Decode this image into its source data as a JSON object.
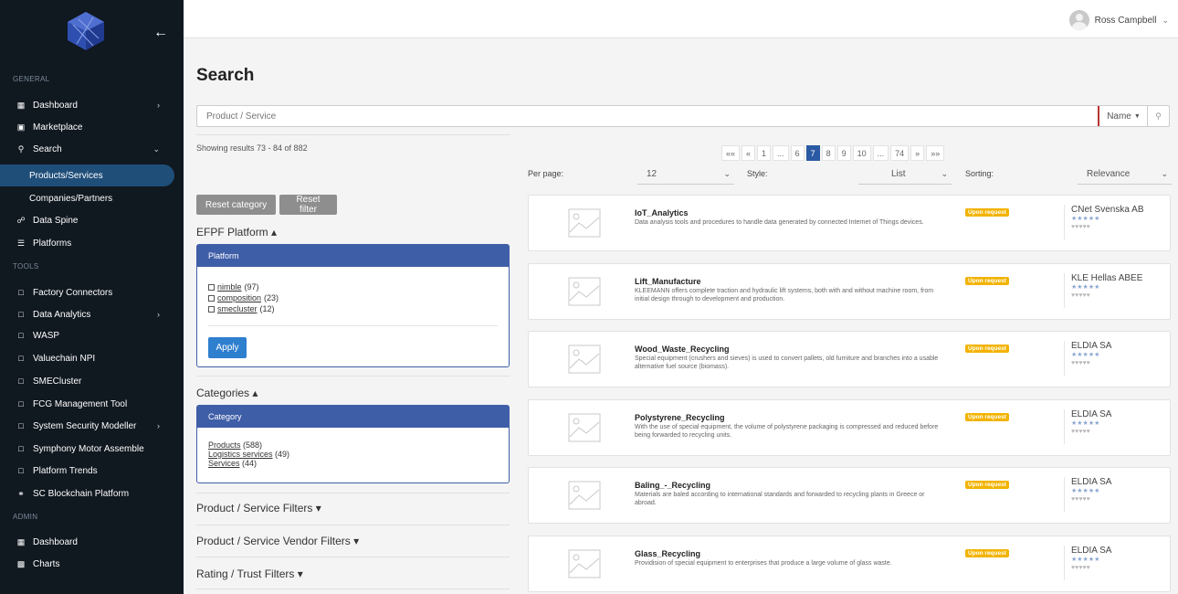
{
  "sidebar": {
    "collapse_icon": "arrow-left-icon",
    "sections": {
      "general": "GENERAL",
      "tools": "TOOLS",
      "admin": "ADMIN"
    },
    "items": [
      {
        "label": "Dashboard"
      },
      {
        "label": "Marketplace"
      },
      {
        "label": "Search"
      },
      {
        "label": "Products/Services"
      },
      {
        "label": "Companies/Partners"
      },
      {
        "label": "Data Spine"
      },
      {
        "label": "Platforms"
      },
      {
        "label": "Factory Connectors"
      },
      {
        "label": "Data Analytics"
      },
      {
        "label": "WASP"
      },
      {
        "label": "Valuechain NPI"
      },
      {
        "label": "SMECluster"
      },
      {
        "label": "FCG Management Tool"
      },
      {
        "label": "System Security Modeller"
      },
      {
        "label": "Symphony Motor Assemble"
      },
      {
        "label": "Platform Trends"
      },
      {
        "label": "SC Blockchain Platform"
      },
      {
        "label": "Dashboard"
      },
      {
        "label": "Charts"
      }
    ]
  },
  "header": {
    "user_name": "Ross Campbell"
  },
  "main": {
    "title": "Search",
    "search": {
      "placeholder": "Product / Service",
      "field_select": "Name"
    },
    "showing": "Showing results 73 - 84 of 882",
    "pagination": [
      "««",
      "«",
      "1",
      "...",
      "6",
      "7",
      "8",
      "9",
      "10",
      "...",
      "74",
      "»",
      "»»"
    ],
    "pagination_active": "7",
    "controls": {
      "per_page_label": "Per page:",
      "per_page_value": "12",
      "style_label": "Style:",
      "style_value": "List",
      "sorting_label": "Sorting:",
      "sorting_value": "Relevance"
    },
    "buttons": {
      "reset_category": "Reset category",
      "reset_filter": "Reset filter",
      "apply": "Apply"
    },
    "filters": {
      "efpf_heading": "EFPF Platform ▴",
      "platform_panel_title": "Platform",
      "platforms": [
        {
          "name": "nimble",
          "count": "(97)"
        },
        {
          "name": "composition",
          "count": "(23)"
        },
        {
          "name": "smecluster",
          "count": "(12)"
        }
      ],
      "categories_heading": "Categories ▴",
      "category_panel_title": "Category",
      "categories": [
        {
          "name": "Products",
          "count": "(588)"
        },
        {
          "name": "Logistics services",
          "count": "(49)"
        },
        {
          "name": "Services",
          "count": "(44)"
        }
      ],
      "product_service_filters": "Product / Service Filters ▾",
      "vendor_filters": "Product / Service Vendor Filters ▾",
      "rating_filters": "Rating / Trust Filters ▾"
    },
    "results": [
      {
        "name": "IoT_Analytics",
        "desc": "Data analysis tools and procedures to handle data generated by connected Internet of Things devices.",
        "badge": "Upon request",
        "vendor": "CNet Svenska AB"
      },
      {
        "name": "Lift_Manufacture",
        "desc": "KLEEMANN offers complete traction and hydraulic lift systems, both with and without machine room, from initial design through to development and production.",
        "badge": "Upon request",
        "vendor": "KLE Hellas ABEE"
      },
      {
        "name": "Wood_Waste_Recycling",
        "desc": "Special equipment (crushers and sieves) is used to convert pallets, old furniture and branches into a usable alternative fuel source (biomass).",
        "badge": "Upon request",
        "vendor": "ELDIA SA"
      },
      {
        "name": "Polystyrene_Recycling",
        "desc": "With the use of special equipment, the volume of polystyrene packaging is compressed and reduced before being forwarded to recycling units.",
        "badge": "Upon request",
        "vendor": "ELDIA SA"
      },
      {
        "name": "Baling_-_Recycling",
        "desc": "Materials are baled according to international standards and forwarded to recycling plants in Greece or abroad.",
        "badge": "Upon request",
        "vendor": "ELDIA SA"
      },
      {
        "name": "Glass_Recycling",
        "desc": "Providision of special equipment to enterprises that produce a large volume of glass waste.",
        "badge": "Upon request",
        "vendor": "ELDIA SA"
      }
    ],
    "colors": {
      "sidebar_bg": "#101820",
      "active_item": "#1f4e79",
      "panel_blue": "#3f5ea8",
      "page_active": "#2b5aa5",
      "apply": "#2f7fcf",
      "badge": "#f2b300"
    }
  }
}
